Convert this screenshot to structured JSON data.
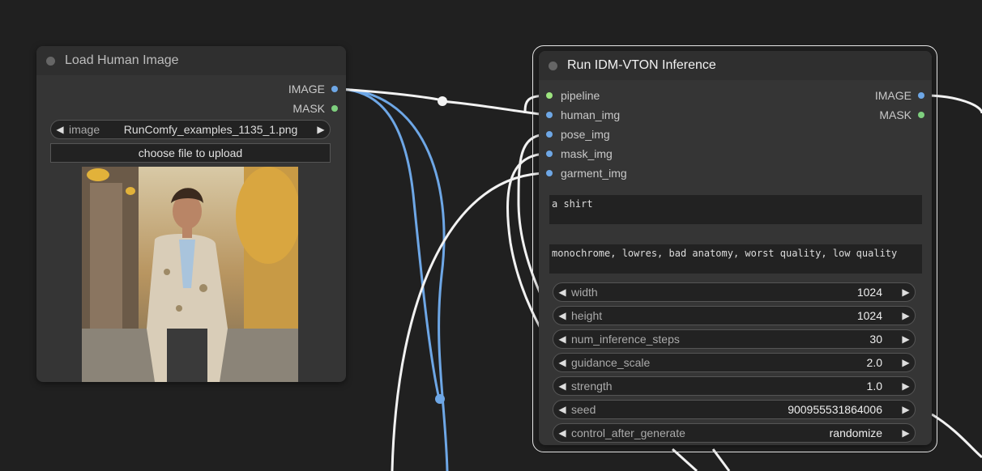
{
  "load_node": {
    "title": "Load Human Image",
    "outputs": [
      {
        "label": "IMAGE",
        "color": "#6ea7e6"
      },
      {
        "label": "MASK",
        "color": "#7ecf7e"
      }
    ],
    "image_widget": {
      "label": "image",
      "value": "RunComfy_examples_1135_1.png"
    },
    "upload_label": "choose file to upload"
  },
  "vton_node": {
    "title": "Run IDM-VTON Inference",
    "inputs": [
      {
        "label": "pipeline",
        "color": "#9de57f"
      },
      {
        "label": "human_img",
        "color": "#6ea7e6"
      },
      {
        "label": "pose_img",
        "color": "#6ea7e6"
      },
      {
        "label": "mask_img",
        "color": "#6ea7e6"
      },
      {
        "label": "garment_img",
        "color": "#6ea7e6"
      }
    ],
    "outputs": [
      {
        "label": "IMAGE",
        "color": "#6ea7e6"
      },
      {
        "label": "MASK",
        "color": "#7ecf7e"
      }
    ],
    "prompt": "a shirt",
    "negative_prompt": "monochrome, lowres, bad anatomy, worst quality, low quality",
    "widgets": [
      {
        "label": "width",
        "value": "1024"
      },
      {
        "label": "height",
        "value": "1024"
      },
      {
        "label": "num_inference_steps",
        "value": "30"
      },
      {
        "label": "guidance_scale",
        "value": "2.0"
      },
      {
        "label": "strength",
        "value": "1.0"
      },
      {
        "label": "seed",
        "value": "900955531864006"
      },
      {
        "label": "control_after_generate",
        "value": "randomize"
      }
    ]
  },
  "icons": {
    "left_arrow": "◀",
    "right_arrow": "▶"
  },
  "colors": {
    "canvas": "#202020",
    "node": "#353535",
    "wire_blue": "#6ea7e6",
    "wire_white": "#f2f2f2"
  }
}
